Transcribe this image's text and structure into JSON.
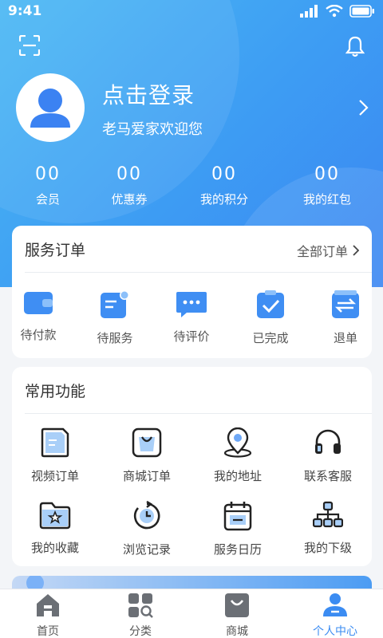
{
  "status_bar": {
    "time": "9:41"
  },
  "profile": {
    "login_text": "点击登录",
    "welcome_text": "老马爱家欢迎您"
  },
  "stats": [
    {
      "value": "00",
      "label": "会员"
    },
    {
      "value": "00",
      "label": "优惠券"
    },
    {
      "value": "00",
      "label": "我的积分"
    },
    {
      "value": "00",
      "label": "我的红包"
    }
  ],
  "orders": {
    "title": "服务订单",
    "all_link": "全部订单",
    "items": [
      {
        "label": "待付款",
        "icon": "wallet-icon"
      },
      {
        "label": "待服务",
        "icon": "pending-service-icon"
      },
      {
        "label": "待评价",
        "icon": "comment-icon"
      },
      {
        "label": "已完成",
        "icon": "checkmark-icon"
      },
      {
        "label": "退单",
        "icon": "refund-icon"
      }
    ]
  },
  "functions": {
    "title": "常用功能",
    "items": [
      {
        "label": "视频订单",
        "icon": "video-order-icon"
      },
      {
        "label": "商城订单",
        "icon": "shopping-bag-icon"
      },
      {
        "label": "我的地址",
        "icon": "location-pin-icon"
      },
      {
        "label": "联系客服",
        "icon": "headset-icon"
      },
      {
        "label": "我的收藏",
        "icon": "favorites-folder-icon"
      },
      {
        "label": "浏览记录",
        "icon": "history-icon"
      },
      {
        "label": "服务日历",
        "icon": "calendar-icon"
      },
      {
        "label": "我的下级",
        "icon": "org-chart-icon"
      }
    ]
  },
  "tabbar": {
    "items": [
      {
        "label": "首页",
        "icon": "home-icon"
      },
      {
        "label": "分类",
        "icon": "category-icon"
      },
      {
        "label": "商城",
        "icon": "shop-icon"
      },
      {
        "label": "个人中心",
        "icon": "user-center-icon"
      }
    ],
    "active_index": 3
  },
  "colors": {
    "accent": "#3b8cf2",
    "hero_start": "#4ab8f3",
    "hero_end": "#3b86f2"
  }
}
